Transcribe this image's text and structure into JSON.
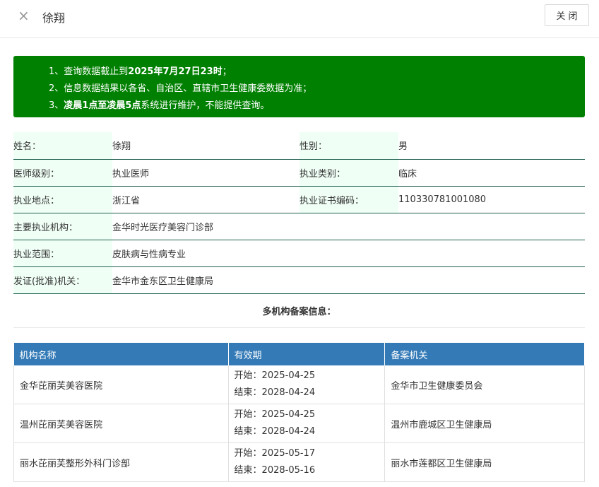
{
  "header": {
    "close_icon": "×",
    "title": "徐翔",
    "close_button": "关 闭"
  },
  "notice": {
    "color": "#008000",
    "lines": [
      [
        "1、查询数据截止到",
        "2025年7月27日23时",
        "；"
      ],
      [
        "2、信息数据结果以各省、自治区、直辖市卫生健康委数据为准；",
        "",
        ""
      ],
      [
        "3、",
        "凌晨1点至凌晨5点",
        "系统进行维护，不能提供查询。"
      ]
    ]
  },
  "info": {
    "name_label": "姓名：",
    "name": "徐翔",
    "gender_label": "性别：",
    "gender": "男",
    "level_label": "医师级别：",
    "level": "执业医师",
    "category_label": "执业类别：",
    "category": "临床",
    "location_label": "执业地点：",
    "location": "浙江省",
    "cert_label": "执业证书编码：",
    "cert": "110330781001080",
    "institution_label": "主要执业机构：",
    "institution": "金华时光医疗美容门诊部",
    "scope_label": "执业范围：",
    "scope": "皮肤病与性病专业",
    "issuer_label": "发证(批准)机关：",
    "issuer": "金华市金东区卫生健康局"
  },
  "multi_title": "多机构备案信息：",
  "org_table": {
    "headers": [
      "机构名称",
      "有效期",
      "备案机关"
    ],
    "rows": [
      {
        "name": "金华芘丽芙美容医院",
        "start": "开始：2025-04-25",
        "end": "结束：2028-04-24",
        "authority": "金华市卫生健康委员会"
      },
      {
        "name": "温州芘丽芙美容医院",
        "start": "开始：2025-04-25",
        "end": "结束：2028-04-24",
        "authority": "温州市鹿城区卫生健康局"
      },
      {
        "name": "丽水芘丽芙整形外科门诊部",
        "start": "开始：2025-05-17",
        "end": "结束：2028-05-16",
        "authority": "丽水市莲都区卫生健康局"
      }
    ]
  }
}
